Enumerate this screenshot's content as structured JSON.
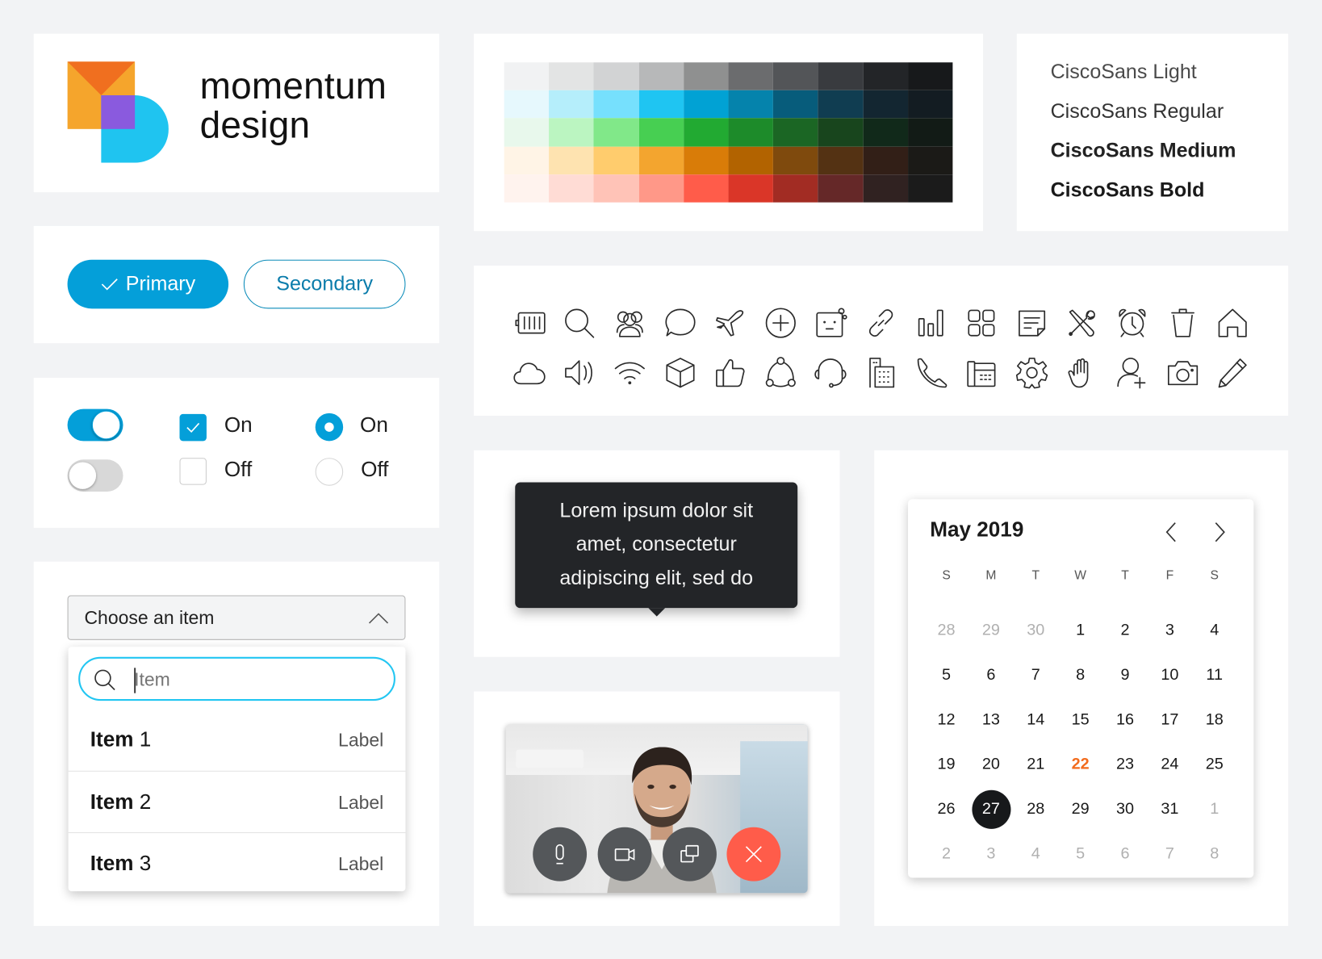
{
  "logo": {
    "line1": "momentum",
    "line2": "design",
    "colors": {
      "orange": "#f5a52c",
      "orange_dark": "#f06f1f",
      "purple": "#8a5ade",
      "cyan": "#1fc4f0"
    }
  },
  "palette": {
    "rows": [
      [
        "#f1f2f3",
        "#e3e4e4",
        "#d2d3d4",
        "#b7b8b9",
        "#8f9090",
        "#6b6c6e",
        "#535558",
        "#393b3f",
        "#232528",
        "#17191b"
      ],
      [
        "#e6f8fd",
        "#b5eefb",
        "#76e0fd",
        "#1fc5f2",
        "#01a2d4",
        "#0583ac",
        "#075c7b",
        "#103d51",
        "#132631",
        "#131c22"
      ],
      [
        "#e8f8ec",
        "#bbf5c1",
        "#81e889",
        "#47cf52",
        "#22aa32",
        "#1d8b2a",
        "#1b6624",
        "#18451d",
        "#11291a",
        "#121b16"
      ],
      [
        "#fff4e6",
        "#fee3b0",
        "#ffcc6d",
        "#f3a52f",
        "#d97c08",
        "#b26300",
        "#7f4a0d",
        "#543213",
        "#321f17",
        "#1b1a17"
      ],
      [
        "#fff3ee",
        "#ffdcd5",
        "#ffc3b7",
        "#ff9888",
        "#ff5c4a",
        "#da3628",
        "#a22c23",
        "#652828",
        "#302221",
        "#1b1b1b"
      ]
    ]
  },
  "typography": {
    "items": [
      {
        "label": "CiscoSans Light",
        "weight": "light"
      },
      {
        "label": "CiscoSans Regular",
        "weight": "regular"
      },
      {
        "label": "CiscoSans Medium",
        "weight": "medium"
      },
      {
        "label": "CiscoSans Bold",
        "weight": "bold"
      }
    ]
  },
  "buttons": {
    "primary_label": "Primary",
    "primary_icon": "check-icon",
    "secondary_label": "Secondary",
    "accent": "#049fd9"
  },
  "controls": {
    "toggle_on": true,
    "toggle_off": false,
    "checkbox_on_label": "On",
    "checkbox_off_label": "Off",
    "radio_on_label": "On",
    "radio_off_label": "Off"
  },
  "dropdown": {
    "selected_label": "Choose an item",
    "search_placeholder": "Item",
    "search_value": "",
    "items": [
      {
        "name_bold": "Item",
        "name_rest": " 1",
        "label": "Label"
      },
      {
        "name_bold": "Item",
        "name_rest": " 2",
        "label": "Label"
      },
      {
        "name_bold": "Item",
        "name_rest": " 3",
        "label": "Label"
      }
    ]
  },
  "icons": [
    "battery-icon",
    "search-icon",
    "people-icon",
    "chat-icon",
    "airplane-icon",
    "plus-circle-icon",
    "bot-icon",
    "link-icon",
    "signal-bars-icon",
    "grid-icon",
    "note-icon",
    "tools-icon",
    "alarm-icon",
    "trash-icon",
    "home-icon",
    "cloud-icon",
    "speaker-icon",
    "wifi-icon",
    "cube-icon",
    "thumbs-up-icon",
    "share-nodes-icon",
    "headset-icon",
    "building-icon",
    "phone-icon",
    "desk-phone-icon",
    "gear-icon",
    "hand-icon",
    "add-user-icon",
    "camera-icon",
    "pencil-icon"
  ],
  "tooltip": {
    "lines": [
      "Lorem ipsum dolor sit",
      "amet, consectetur",
      "adipiscing elit, sed do"
    ]
  },
  "video_call": {
    "controls": [
      {
        "name": "mute-button",
        "icon": "microphone-icon"
      },
      {
        "name": "video-button",
        "icon": "video-camera-icon"
      },
      {
        "name": "share-screen-button",
        "icon": "share-screen-icon"
      },
      {
        "name": "end-call-button",
        "icon": "close-icon"
      }
    ],
    "end_color": "#ff5c4a"
  },
  "calendar": {
    "title": "May 2019",
    "weekdays": [
      "S",
      "M",
      "T",
      "W",
      "T",
      "F",
      "S"
    ],
    "today": 22,
    "selected": 27,
    "weeks": [
      [
        {
          "d": "28",
          "m": true
        },
        {
          "d": "29",
          "m": true
        },
        {
          "d": "30",
          "m": true
        },
        {
          "d": "1"
        },
        {
          "d": "2"
        },
        {
          "d": "3"
        },
        {
          "d": "4"
        }
      ],
      [
        {
          "d": "5"
        },
        {
          "d": "6"
        },
        {
          "d": "7"
        },
        {
          "d": "8"
        },
        {
          "d": "9"
        },
        {
          "d": "10"
        },
        {
          "d": "11"
        }
      ],
      [
        {
          "d": "12"
        },
        {
          "d": "13"
        },
        {
          "d": "14"
        },
        {
          "d": "15"
        },
        {
          "d": "16"
        },
        {
          "d": "17"
        },
        {
          "d": "18"
        }
      ],
      [
        {
          "d": "19"
        },
        {
          "d": "20"
        },
        {
          "d": "21"
        },
        {
          "d": "22",
          "t": true
        },
        {
          "d": "23"
        },
        {
          "d": "24"
        },
        {
          "d": "25"
        }
      ],
      [
        {
          "d": "26"
        },
        {
          "d": "27",
          "s": true
        },
        {
          "d": "28"
        },
        {
          "d": "29"
        },
        {
          "d": "30"
        },
        {
          "d": "31"
        },
        {
          "d": "1",
          "m": true
        }
      ],
      [
        {
          "d": "2",
          "m": true
        },
        {
          "d": "3",
          "m": true
        },
        {
          "d": "4",
          "m": true
        },
        {
          "d": "5",
          "m": true
        },
        {
          "d": "6",
          "m": true
        },
        {
          "d": "7",
          "m": true
        },
        {
          "d": "8",
          "m": true
        }
      ]
    ]
  }
}
